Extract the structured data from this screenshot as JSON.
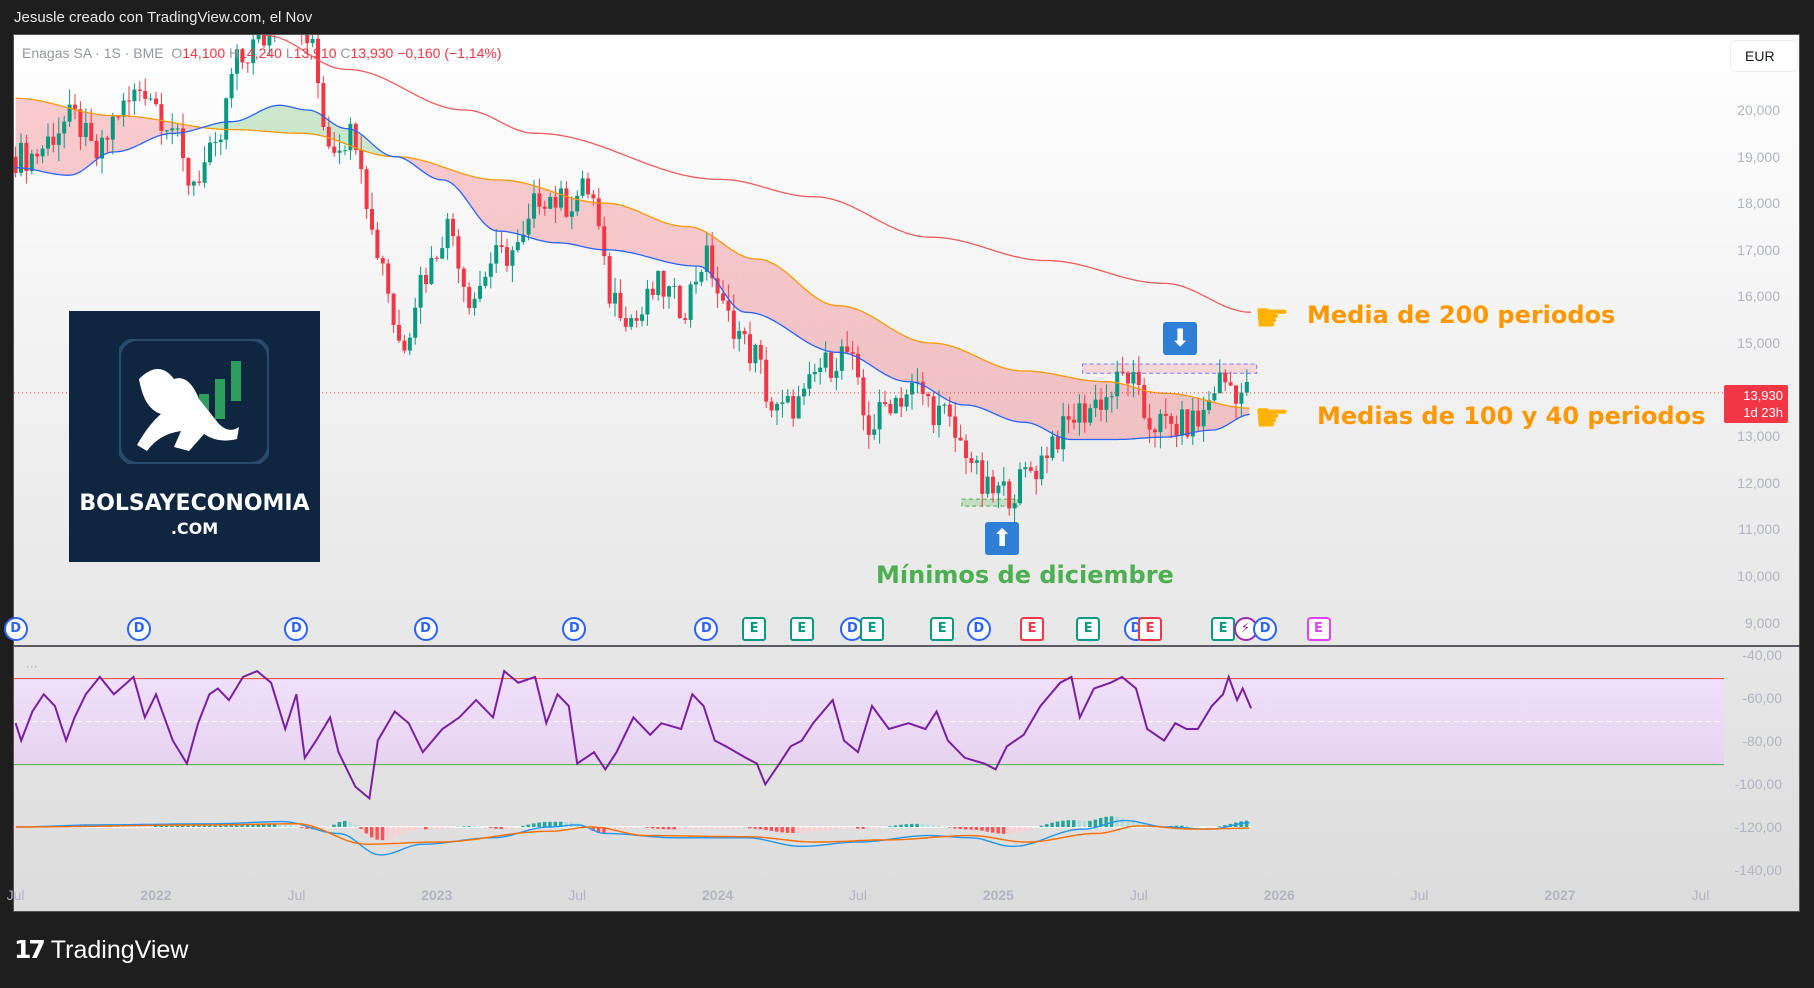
{
  "header": {
    "title": "Jesusle creado con TradingView.com, el Nov"
  },
  "legend": {
    "symbol": "Enagas SA · 1S · BME",
    "open_label": "O",
    "open": "14,100",
    "high_label": "H",
    "high": "14,240",
    "low_label": "L",
    "low": "13,910",
    "close_label": "C",
    "close": "13,930",
    "change": "−0,160 (−1,14%)"
  },
  "currency_button": "EUR",
  "current_price": {
    "value": "13,930",
    "countdown": "1d 23h"
  },
  "price_axis": [
    "20,000",
    "19,000",
    "18,000",
    "17,000",
    "16,000",
    "15,000",
    "13,000",
    "12,000",
    "11,000",
    "10,000",
    "9,000"
  ],
  "price_axis_values": [
    20,
    19,
    18,
    17,
    16,
    15,
    13,
    12,
    11,
    10,
    9
  ],
  "indicator_axis": [
    "-40,00",
    "-60,00",
    "-80,00",
    "-100,00",
    "-120,00",
    "-140,00"
  ],
  "indicator_axis_values": [
    -40,
    -60,
    -80,
    -100,
    -120,
    -140
  ],
  "time_axis": [
    {
      "label": "Jul",
      "t": 2021.5,
      "major": false
    },
    {
      "label": "2022",
      "t": 2022,
      "major": true
    },
    {
      "label": "Jul",
      "t": 2022.5,
      "major": false
    },
    {
      "label": "2023",
      "t": 2023,
      "major": true
    },
    {
      "label": "Jul",
      "t": 2023.5,
      "major": false
    },
    {
      "label": "2024",
      "t": 2024,
      "major": true
    },
    {
      "label": "Jul",
      "t": 2024.5,
      "major": false
    },
    {
      "label": "2025",
      "t": 2025,
      "major": true
    },
    {
      "label": "Jul",
      "t": 2025.5,
      "major": false
    },
    {
      "label": "2026",
      "t": 2026,
      "major": true
    },
    {
      "label": "Jul",
      "t": 2026.5,
      "major": false
    },
    {
      "label": "2027",
      "t": 2027,
      "major": true
    },
    {
      "label": "Jul",
      "t": 2027.5,
      "major": false
    }
  ],
  "logo": {
    "line1": "BOLSAYECONOMIA",
    "line2": ".COM"
  },
  "annotations": {
    "ma200": "Media de 200 periodos",
    "ma100_40": "Medias de 100 y 40 periodos",
    "lows": "Mínimos de diciembre",
    "more": "···"
  },
  "events": [
    {
      "type": "D",
      "t": 2021.5
    },
    {
      "type": "D",
      "t": 2021.94
    },
    {
      "type": "D",
      "t": 2022.5
    },
    {
      "type": "D",
      "t": 2022.96
    },
    {
      "type": "D",
      "t": 2023.49
    },
    {
      "type": "D",
      "t": 2023.96
    },
    {
      "type": "E+",
      "t": 2024.13
    },
    {
      "type": "E+",
      "t": 2024.3
    },
    {
      "type": "D",
      "t": 2024.48
    },
    {
      "type": "E+",
      "t": 2024.55
    },
    {
      "type": "E+",
      "t": 2024.8
    },
    {
      "type": "D",
      "t": 2024.93
    },
    {
      "type": "E-",
      "t": 2025.12
    },
    {
      "type": "E+",
      "t": 2025.32
    },
    {
      "type": "D",
      "t": 2025.49
    },
    {
      "type": "E-",
      "t": 2025.54
    },
    {
      "type": "E+",
      "t": 2025.8
    },
    {
      "type": "S",
      "t": 2025.88
    },
    {
      "type": "D",
      "t": 2025.95
    },
    {
      "type": "EP",
      "t": 2026.14
    }
  ],
  "colors": {
    "up": "#089981",
    "down": "#f23645",
    "ma200": "#f45b5b",
    "ma100": "#ff9800",
    "ma40": "#2962ff",
    "rsi": "#7b1fa2",
    "macd": "#2196f3",
    "signal": "#ff6d00",
    "lows": "#4caf50"
  },
  "chart_data": {
    "type": "candlestick",
    "title": "Enagas SA · 1S · BME",
    "price_waypoints": [
      [
        "2021-07",
        19.0
      ],
      [
        "2021-09",
        19.8
      ],
      [
        "2021-10",
        19.0
      ],
      [
        "2021-11",
        20.0
      ],
      [
        "2021-12",
        20.5
      ],
      [
        "2022-01",
        19.8
      ],
      [
        "2022-02",
        18.5
      ],
      [
        "2022-03",
        19.0
      ],
      [
        "2022-04",
        21.0
      ],
      [
        "2022-05",
        21.5
      ],
      [
        "2022-06",
        22.3
      ],
      [
        "2022-07",
        21.5
      ],
      [
        "2022-08",
        19.3
      ],
      [
        "2022-09",
        19.5
      ],
      [
        "2022-10",
        17.0
      ],
      [
        "2022-11",
        15.0
      ],
      [
        "2022-12",
        16.5
      ],
      [
        "2023-01",
        17.5
      ],
      [
        "2023-02",
        16.0
      ],
      [
        "2023-03",
        16.8
      ],
      [
        "2023-04",
        17.0
      ],
      [
        "2023-05",
        18.2
      ],
      [
        "2023-06",
        18.0
      ],
      [
        "2023-07",
        18.3
      ],
      [
        "2023-08",
        16.0
      ],
      [
        "2023-09",
        15.5
      ],
      [
        "2023-10",
        16.2
      ],
      [
        "2023-11",
        15.8
      ],
      [
        "2023-12",
        16.8
      ],
      [
        "2024-01",
        15.5
      ],
      [
        "2024-02",
        14.8
      ],
      [
        "2024-03",
        13.5
      ],
      [
        "2024-04",
        13.7
      ],
      [
        "2024-05",
        14.5
      ],
      [
        "2024-06",
        14.8
      ],
      [
        "2024-07",
        13.2
      ],
      [
        "2024-08",
        13.8
      ],
      [
        "2024-09",
        14.0
      ],
      [
        "2024-10",
        13.5
      ],
      [
        "2024-11",
        12.8
      ],
      [
        "2024-12",
        11.8
      ],
      [
        "2025-01",
        11.8
      ],
      [
        "2025-02",
        12.3
      ],
      [
        "2025-03",
        13.0
      ],
      [
        "2025-04",
        13.5
      ],
      [
        "2025-05",
        13.8
      ],
      [
        "2025-06",
        14.3
      ],
      [
        "2025-07",
        13.3
      ],
      [
        "2025-08",
        13.2
      ],
      [
        "2025-09",
        13.3
      ],
      [
        "2025-10",
        14.2
      ],
      [
        "2025-11",
        13.93
      ]
    ],
    "ma200": [
      [
        2022.39,
        21.6
      ],
      [
        2022.68,
        20.87
      ],
      [
        2023.1,
        20.0
      ],
      [
        2023.35,
        19.5
      ],
      [
        2024.01,
        18.51
      ],
      [
        2024.34,
        18.14
      ],
      [
        2024.76,
        17.27
      ],
      [
        2025.17,
        16.77
      ],
      [
        2025.59,
        16.28
      ],
      [
        2025.9,
        15.66
      ]
    ],
    "ma100": [
      [
        2021.5,
        20.25
      ],
      [
        2021.85,
        19.88
      ],
      [
        2022.27,
        19.58
      ],
      [
        2022.52,
        19.5
      ],
      [
        2022.85,
        19.0
      ],
      [
        2023.22,
        18.5
      ],
      [
        2023.6,
        18.0
      ],
      [
        2023.89,
        17.5
      ],
      [
        2024.14,
        16.8
      ],
      [
        2024.43,
        15.8
      ],
      [
        2024.76,
        15.0
      ],
      [
        2025.09,
        14.4
      ],
      [
        2025.38,
        14.17
      ],
      [
        2025.59,
        13.92
      ],
      [
        2025.9,
        13.6
      ]
    ],
    "ma40": [
      [
        2021.5,
        18.76
      ],
      [
        2021.69,
        18.6
      ],
      [
        2021.85,
        19.1
      ],
      [
        2022.06,
        19.5
      ],
      [
        2022.27,
        19.75
      ],
      [
        2022.44,
        20.1
      ],
      [
        2022.54,
        20.0
      ],
      [
        2022.68,
        19.6
      ],
      [
        2022.85,
        19.0
      ],
      [
        2023.02,
        18.5
      ],
      [
        2023.22,
        17.4
      ],
      [
        2023.43,
        17.15
      ],
      [
        2023.6,
        17.0
      ],
      [
        2023.93,
        16.65
      ],
      [
        2024.1,
        15.66
      ],
      [
        2024.43,
        14.8
      ],
      [
        2024.68,
        14.17
      ],
      [
        2024.88,
        13.67
      ],
      [
        2025.09,
        13.3
      ],
      [
        2025.26,
        12.93
      ],
      [
        2025.42,
        12.93
      ],
      [
        2025.59,
        12.98
      ],
      [
        2025.76,
        13.13
      ],
      [
        2025.9,
        13.47
      ]
    ],
    "resistance_zone": [
      14.35,
      14.55
    ],
    "support_zone": [
      11.5,
      11.65
    ],
    "last_price": 13.93,
    "rsi_levels": {
      "upper": -51,
      "middle": -71,
      "lower": -91
    },
    "rsi": {
      "t": [
        2021.5,
        2021.52,
        2021.56,
        2021.6,
        2021.64,
        2021.68,
        2021.71,
        2021.75,
        2021.8,
        2021.85,
        2021.92,
        2021.96,
        2022.0,
        2022.06,
        2022.11,
        2022.15,
        2022.19,
        2022.22,
        2022.26,
        2022.31,
        2022.36,
        2022.41,
        2022.46,
        2022.5,
        2022.53,
        2022.57,
        2022.62,
        2022.65,
        2022.71,
        2022.76,
        2022.79,
        2022.85,
        2022.9,
        2022.95,
        2023.02,
        2023.08,
        2023.14,
        2023.2,
        2023.24,
        2023.29,
        2023.35,
        2023.39,
        2023.43,
        2023.47,
        2023.5,
        2023.56,
        2023.6,
        2023.64,
        2023.7,
        2023.76,
        2023.8,
        2023.87,
        2023.91,
        2023.95,
        2023.99,
        2024.03,
        2024.1,
        2024.14,
        2024.17,
        2024.22,
        2024.26,
        2024.3,
        2024.34,
        2024.41,
        2024.45,
        2024.5,
        2024.55,
        2024.61,
        2024.68,
        2024.74,
        2024.78,
        2024.82,
        2024.88,
        2024.95,
        2024.99,
        2025.03,
        2025.09,
        2025.15,
        2025.22,
        2025.26,
        2025.29,
        2025.34,
        2025.4,
        2025.44,
        2025.49,
        2025.53,
        2025.59,
        2025.63,
        2025.67,
        2025.71,
        2025.76,
        2025.8,
        2025.82,
        2025.85,
        2025.87,
        2025.9
      ],
      "v": [
        -71.7,
        -79.8,
        -66.3,
        -58.3,
        -63.7,
        -79.8,
        -69,
        -58.3,
        -50.2,
        -58.3,
        -50.2,
        -69,
        -58.3,
        -79.8,
        -90.5,
        -71.7,
        -58.3,
        -55.6,
        -61,
        -50.2,
        -47.5,
        -52.9,
        -74.4,
        -58.3,
        -87.8,
        -79.8,
        -69,
        -85.2,
        -101.3,
        -106.7,
        -79.8,
        -66.3,
        -71.7,
        -85.2,
        -74.4,
        -69,
        -61,
        -69,
        -47.5,
        -52.9,
        -50.2,
        -71.7,
        -58.3,
        -63.7,
        -90.5,
        -85.2,
        -93.2,
        -85.2,
        -69,
        -77.1,
        -71.7,
        -74.4,
        -58.3,
        -63.7,
        -79.8,
        -82.5,
        -87.8,
        -90.5,
        -100.2,
        -90.5,
        -82.5,
        -79.8,
        -71.7,
        -61,
        -79.8,
        -85.2,
        -63.7,
        -74.4,
        -71.7,
        -74.4,
        -66.3,
        -79.8,
        -87.8,
        -90.5,
        -93.2,
        -82.5,
        -77.1,
        -63.7,
        -52.9,
        -50.2,
        -69,
        -55.6,
        -52.9,
        -50.2,
        -55.6,
        -74.4,
        -79.8,
        -71.7,
        -74.4,
        -74.4,
        -63.7,
        -58.3,
        -50.2,
        -61,
        -55.6,
        -64.8
      ]
    },
    "macd_zero": -120,
    "macd": [
      [
        2021.5,
        0
      ],
      [
        2021.8,
        1
      ],
      [
        2022.2,
        1.5
      ],
      [
        2022.45,
        2.5
      ],
      [
        2022.65,
        -3
      ],
      [
        2022.8,
        -13
      ],
      [
        2022.95,
        -8
      ],
      [
        2023.2,
        -5
      ],
      [
        2023.4,
        0
      ],
      [
        2023.5,
        1
      ],
      [
        2023.6,
        -3
      ],
      [
        2023.85,
        -5
      ],
      [
        2024.1,
        -5
      ],
      [
        2024.3,
        -9
      ],
      [
        2024.5,
        -7
      ],
      [
        2024.75,
        -4
      ],
      [
        2024.9,
        -5
      ],
      [
        2025.05,
        -9
      ],
      [
        2025.3,
        -1
      ],
      [
        2025.45,
        3
      ],
      [
        2025.6,
        0
      ],
      [
        2025.75,
        -1
      ],
      [
        2025.9,
        2
      ]
    ],
    "signal": [
      [
        2021.5,
        0
      ],
      [
        2022.2,
        1
      ],
      [
        2022.5,
        1.5
      ],
      [
        2022.75,
        -8
      ],
      [
        2023.0,
        -7
      ],
      [
        2023.4,
        -2
      ],
      [
        2023.55,
        0
      ],
      [
        2023.75,
        -4
      ],
      [
        2024.1,
        -4.5
      ],
      [
        2024.35,
        -7
      ],
      [
        2024.6,
        -6
      ],
      [
        2024.9,
        -4
      ],
      [
        2025.1,
        -7
      ],
      [
        2025.35,
        -3
      ],
      [
        2025.5,
        0.5
      ],
      [
        2025.7,
        -1
      ],
      [
        2025.9,
        -0.5
      ]
    ]
  }
}
